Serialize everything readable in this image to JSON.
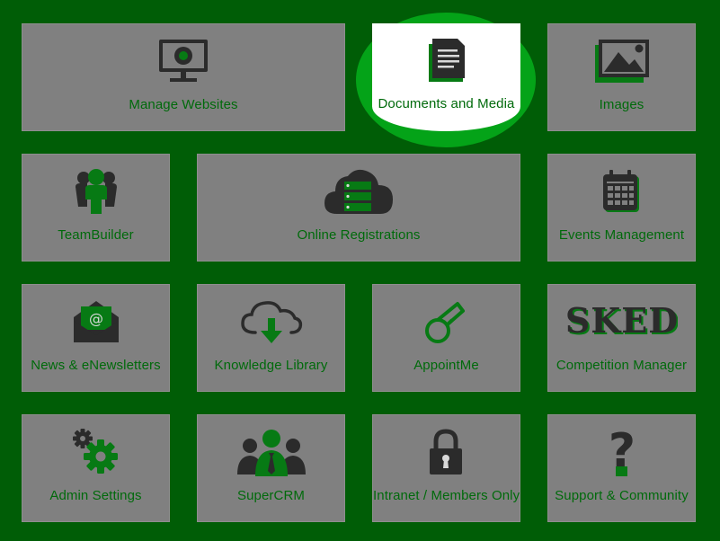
{
  "colors": {
    "background": "#005d06",
    "tile": "#808080",
    "label": "#006a0b",
    "icon_dark": "#2b2b2b",
    "icon_green": "#077a14",
    "spotlight_ring": "#04a318"
  },
  "tiles": [
    {
      "label": "Manage Websites",
      "icon": "monitor-icon"
    },
    {
      "label": "Documents and Media",
      "icon": "document-icon"
    },
    {
      "label": "Images",
      "icon": "image-icon"
    },
    {
      "label": "TeamBuilder",
      "icon": "team-icon"
    },
    {
      "label": "Online Registrations",
      "icon": "cloud-server-icon"
    },
    {
      "label": "Events Management",
      "icon": "calendar-icon"
    },
    {
      "label": "News & eNewsletters",
      "icon": "envelope-icon"
    },
    {
      "label": "Knowledge Library",
      "icon": "cloud-download-icon"
    },
    {
      "label": "AppointMe",
      "icon": "whistle-icon"
    },
    {
      "label": "Competition Manager",
      "icon": "sked-logo-icon",
      "logo_text": "SKED"
    },
    {
      "label": "Admin Settings",
      "icon": "gears-icon"
    },
    {
      "label": "SuperCRM",
      "icon": "people-icon"
    },
    {
      "label": "Intranet / Members Only",
      "icon": "lock-icon"
    },
    {
      "label": "Support & Community",
      "icon": "question-icon",
      "glyph": "?"
    }
  ]
}
